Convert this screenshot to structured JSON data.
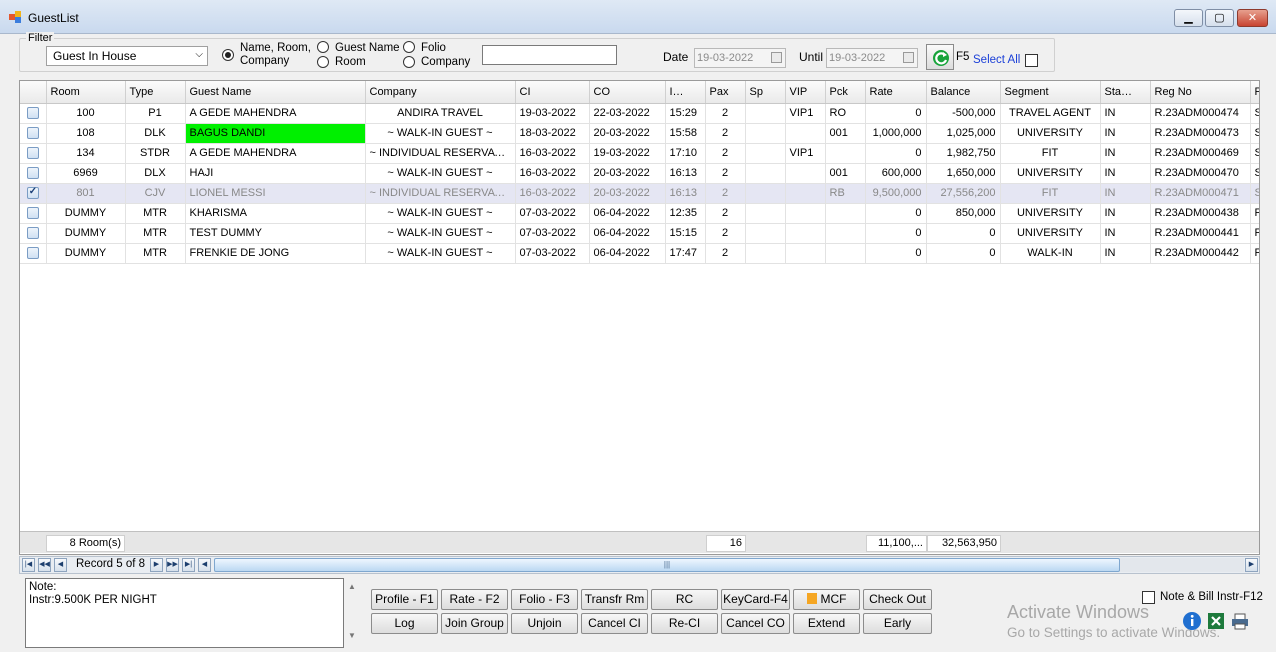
{
  "window": {
    "title": "GuestList"
  },
  "filter": {
    "legend": "Filter",
    "status_selected": "Guest In House",
    "radios": [
      {
        "label": "Name, Room,\nCompany",
        "checked": true
      },
      {
        "label": "Guest Name",
        "checked": false
      },
      {
        "label": "Room",
        "checked": false
      },
      {
        "label": "Folio",
        "checked": false
      },
      {
        "label": "Company",
        "checked": false
      }
    ],
    "search_value": "",
    "date_label": "Date",
    "date_value": "19-03-2022",
    "until_label": "Until",
    "until_value": "19-03-2022",
    "refresh_key": "F5",
    "select_all_label": "Select All"
  },
  "table": {
    "columns": [
      "",
      "Room",
      "Type",
      "Guest Name",
      "Company",
      "CI",
      "CO",
      "I…",
      "Pax",
      "Sp",
      "VIP",
      "Pck",
      "Rate",
      "Balance",
      "Segment",
      "Sta…",
      "Reg No",
      "P"
    ],
    "rows": [
      {
        "checked": false,
        "room": "100",
        "type": "P1",
        "guest": "A GEDE MAHENDRA",
        "company": "ANDIRA TRAVEL",
        "ci": "19-03-2022",
        "co": "22-03-2022",
        "time": "15:29",
        "pax": "2",
        "sp": "",
        "vip": "VIP1",
        "pck": "RO",
        "rate": "0",
        "balance": "-500,000",
        "segment": "TRAVEL AGENT",
        "status": "IN",
        "regno": "R.23ADM000474",
        "p": "S"
      },
      {
        "checked": false,
        "room": "108",
        "type": "DLK",
        "guest": "BAGUS DANDI",
        "company": "~ WALK-IN GUEST ~",
        "ci": "18-03-2022",
        "co": "20-03-2022",
        "time": "15:58",
        "pax": "2",
        "sp": "",
        "vip": "",
        "pck": "001",
        "rate": "1,000,000",
        "balance": "1,025,000",
        "segment": "UNIVERSITY",
        "status": "IN",
        "regno": "R.23ADM000473",
        "p": "S",
        "highlight_guest": true
      },
      {
        "checked": false,
        "room": "134",
        "type": "STDR",
        "guest": "A GEDE MAHENDRA",
        "company": "~ INDIVIDUAL RESERVATI...",
        "ci": "16-03-2022",
        "co": "19-03-2022",
        "time": "17:10",
        "pax": "2",
        "sp": "",
        "vip": "VIP1",
        "pck": "",
        "rate": "0",
        "balance": "1,982,750",
        "segment": "FIT",
        "status": "IN",
        "regno": "R.23ADM000469",
        "p": "S"
      },
      {
        "checked": false,
        "room": "6969",
        "type": "DLX",
        "guest": "HAJI",
        "company": "~ WALK-IN GUEST ~",
        "ci": "16-03-2022",
        "co": "20-03-2022",
        "time": "16:13",
        "pax": "2",
        "sp": "",
        "vip": "",
        "pck": "001",
        "rate": "600,000",
        "balance": "1,650,000",
        "segment": "UNIVERSITY",
        "status": "IN",
        "regno": "R.23ADM000470",
        "p": "S"
      },
      {
        "checked": true,
        "room": "801",
        "type": "CJV",
        "guest": "LIONEL MESSI",
        "company": "~ INDIVIDUAL RESERVATI...",
        "ci": "16-03-2022",
        "co": "20-03-2022",
        "time": "16:13",
        "pax": "2",
        "sp": "",
        "vip": "",
        "pck": "RB",
        "rate": "9,500,000",
        "balance": "27,556,200",
        "segment": "FIT",
        "status": "IN",
        "regno": "R.23ADM000471",
        "p": "S",
        "selected": true
      },
      {
        "checked": false,
        "room": "DUMMY",
        "type": "MTR",
        "guest": "KHARISMA",
        "company": "~ WALK-IN GUEST ~",
        "ci": "07-03-2022",
        "co": "06-04-2022",
        "time": "12:35",
        "pax": "2",
        "sp": "",
        "vip": "",
        "pck": "",
        "rate": "0",
        "balance": "850,000",
        "segment": "UNIVERSITY",
        "status": "IN",
        "regno": "R.23ADM000438",
        "p": "R"
      },
      {
        "checked": false,
        "room": "DUMMY",
        "type": "MTR",
        "guest": "TEST DUMMY",
        "company": "~ WALK-IN GUEST ~",
        "ci": "07-03-2022",
        "co": "06-04-2022",
        "time": "15:15",
        "pax": "2",
        "sp": "",
        "vip": "",
        "pck": "",
        "rate": "0",
        "balance": "0",
        "segment": "UNIVERSITY",
        "status": "IN",
        "regno": "R.23ADM000441",
        "p": "R"
      },
      {
        "checked": false,
        "room": "DUMMY",
        "type": "MTR",
        "guest": "FRENKIE DE JONG",
        "company": "~ WALK-IN GUEST ~",
        "ci": "07-03-2022",
        "co": "06-04-2022",
        "time": "17:47",
        "pax": "2",
        "sp": "",
        "vip": "",
        "pck": "",
        "rate": "0",
        "balance": "0",
        "segment": "WALK-IN",
        "status": "IN",
        "regno": "R.23ADM000442",
        "p": "R"
      }
    ],
    "footer": {
      "rooms": "8 Room(s)",
      "pax": "16",
      "rate": "11,100,...",
      "balance": "32,563,950"
    }
  },
  "navigator": {
    "record_text": "Record 5 of 8"
  },
  "note": {
    "label": "Note:",
    "text": "Instr:9.500K PER NIGHT"
  },
  "buttons": {
    "profile": "Profile - F1",
    "rate": "Rate - F2",
    "folio": "Folio - F3",
    "transfer_room": "Transfr Rm",
    "rc": "RC",
    "keycard": "KeyCard-F4",
    "mcf": "MCF",
    "check_out": "Check Out",
    "log": "Log",
    "join_group": "Join Group",
    "unjoin": "Unjoin",
    "cancel_ci": "Cancel CI",
    "re_ci": "Re-CI",
    "cancel_co": "Cancel CO",
    "extend": "Extend",
    "early": "Early"
  },
  "note_bill_label": "Note & Bill Instr-F12",
  "activation": {
    "line1": "Activate Windows",
    "line2": "Go to Settings to activate Windows."
  },
  "colors": {
    "highlight_green": "#00f000",
    "selected_row": "#e5e6f3",
    "link_blue": "#1a3fd8"
  }
}
